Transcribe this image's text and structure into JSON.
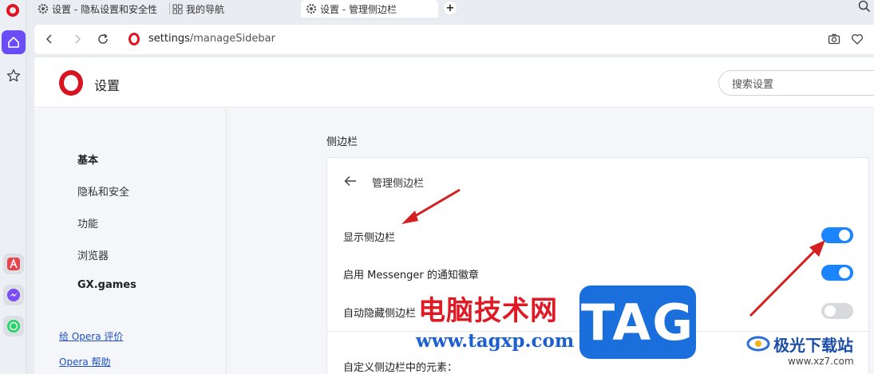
{
  "tabs": [
    {
      "label": "设置 - 隐私设置和安全性"
    },
    {
      "label": "我的导航"
    },
    {
      "label": "设置 - 管理侧边栏"
    }
  ],
  "newtab_label": "+",
  "address": {
    "host": "settings",
    "path": "/manageSidebar"
  },
  "settings": {
    "title": "设置",
    "search_placeholder": "搜索设置"
  },
  "leftnav": {
    "items": [
      "基本",
      "隐私和安全",
      "功能",
      "浏览器",
      "GX.games"
    ],
    "links": [
      "给 Opera 评价",
      "Opera 帮助"
    ]
  },
  "content": {
    "section_title": "侧边栏",
    "card_title": "管理侧边栏",
    "rows": [
      {
        "label": "显示侧边栏",
        "on": true
      },
      {
        "label": "启用 Messenger 的通知徽章",
        "on": true
      },
      {
        "label": "自动隐藏侧边栏",
        "on": false
      }
    ],
    "custom_label": "自定义侧边栏中的元素："
  },
  "watermark": {
    "cn": "电脑技术网",
    "url": "www.tagxp.com",
    "tag": "TAG",
    "jg_cn": "极光下载站",
    "jg_url": "www.xz7.com"
  },
  "colors": {
    "accent": "#1a85ff",
    "opera_red": "#e0131f",
    "sidebar_active": "#6a4df5",
    "arrow": "#d42020"
  }
}
